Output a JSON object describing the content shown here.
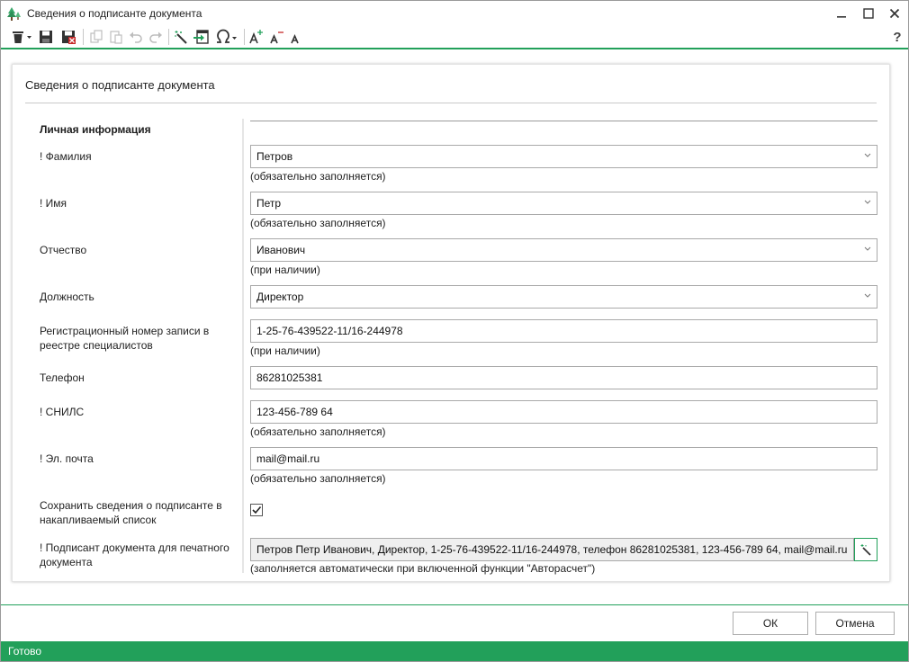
{
  "window": {
    "title": "Сведения о подписанте документа"
  },
  "toolbar": {
    "help_label": "?"
  },
  "card": {
    "title": "Сведения о подписанте документа",
    "section_title": "Личная информация"
  },
  "fields": {
    "last_name": {
      "label": "! Фамилия",
      "value": "Петров",
      "hint": "(обязательно заполняется)"
    },
    "first_name": {
      "label": "! Имя",
      "value": "Петр",
      "hint": "(обязательно заполняется)"
    },
    "patronymic": {
      "label": "Отчество",
      "value": "Иванович",
      "hint": "(при наличии)"
    },
    "position": {
      "label": "Должность",
      "value": "Директор"
    },
    "reg_number": {
      "label": "Регистрационный номер записи в реестре специалистов",
      "value": "1-25-76-439522-11/16-244978",
      "hint": "(при наличии)"
    },
    "phone": {
      "label": "Телефон",
      "value": "86281025381"
    },
    "snils": {
      "label": "! СНИЛС",
      "value": "123-456-789 64",
      "hint": "(обязательно заполняется)"
    },
    "email": {
      "label": "! Эл. почта",
      "value": "mail@mail.ru",
      "hint": "(обязательно заполняется)"
    },
    "save_to_list": {
      "label": "Сохранить сведения о подписанте в накапливаемый список",
      "checked": true
    },
    "signer_print": {
      "label": "! Подписант документа для печатного документа",
      "value": "Петров Петр Иванович, Директор, 1-25-76-439522-11/16-244978, телефон 86281025381, 123-456-789 64, mail@mail.ru",
      "hint": "(заполняется автоматически при включенной функции \"Авторасчет\")"
    }
  },
  "buttons": {
    "ok": "ОК",
    "cancel": "Отмена"
  },
  "status": {
    "text": "Готово"
  },
  "colors": {
    "accent": "#22a05a",
    "statusbar": "#22a05a"
  },
  "icons": {
    "app": "tree-icon",
    "toolbar": [
      "delete-icon",
      "save-icon",
      "save-close-icon",
      "copy-icon",
      "paste-icon",
      "undo-icon",
      "redo-icon",
      "magic-wand-icon",
      "import-icon",
      "omega-icon",
      "font-increase-icon",
      "font-decrease-icon",
      "font-reset-icon",
      "help-icon"
    ]
  }
}
